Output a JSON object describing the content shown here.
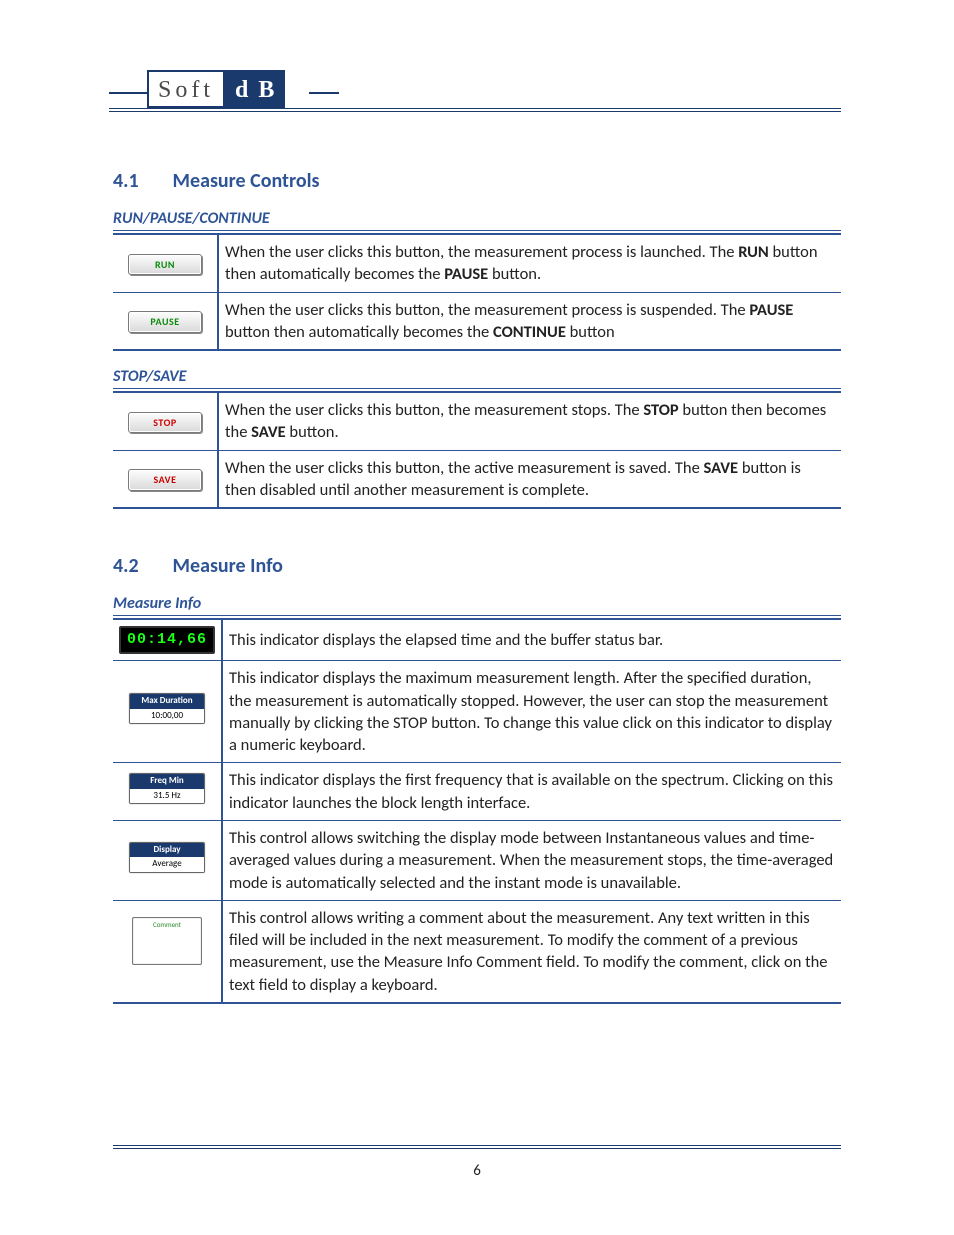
{
  "brand": {
    "left": "Soft",
    "right": "d B"
  },
  "sections": {
    "s41": {
      "num": "4.1",
      "title": "Measure Controls"
    },
    "s42": {
      "num": "4.2",
      "title": "Measure Info"
    }
  },
  "sub_run": "RUN/PAUSE/CONTINUE",
  "sub_stop": "STOP/SAVE",
  "sub_info": "Measure Info",
  "btn": {
    "run": "RUN",
    "pause": "PAUSE",
    "stop": "STOP",
    "save": "SAVE"
  },
  "row_run": {
    "pre": "When the user clicks this button, the measurement process is launched. The ",
    "b1": "RUN",
    "mid": " button then automatically becomes the ",
    "b2": "PAUSE",
    "post": " button."
  },
  "row_pause": {
    "pre": "When the user clicks this button, the measurement process is suspended. The ",
    "b1": "PAUSE",
    "mid": " button then automatically becomes the ",
    "b2": "CONTINUE",
    "post": " button"
  },
  "row_stop": {
    "pre": "When the user clicks this button, the measurement stops. The ",
    "b1": "STOP",
    "mid": " button then becomes the ",
    "b2": "SAVE",
    "post": " button."
  },
  "row_save": {
    "pre": "When the user clicks this button, the active measurement is saved. The ",
    "b1": "SAVE",
    "mid": " button is then disabled until another measurement is complete.",
    "b2": "",
    "post": ""
  },
  "info": {
    "timer_value": "00:14,66",
    "timer_desc": "This indicator displays the elapsed time and the buffer status bar.",
    "maxdur_label": "Max Duration",
    "maxdur_value": "10:00,00",
    "maxdur_desc": "This indicator displays the maximum measurement length. After the specified duration, the measurement is automatically stopped. However, the user can stop the measurement manually by clicking the STOP button. To change this value click on this indicator to display a numeric keyboard.",
    "freq_label": "Freq Min",
    "freq_value": "31.5 Hz",
    "freq_desc": "This indicator displays the first frequency that is available on the spectrum. Clicking on this indicator launches the block length interface.",
    "disp_label": "Display",
    "disp_value": "Average",
    "disp_desc": "This control allows switching the display mode between Instantaneous values and time-averaged values during a measurement. When the measurement stops, the time-averaged mode is automatically selected and the instant mode is unavailable.",
    "comment_label": "Comment",
    "comment_desc": "This control allows writing a comment about the measurement. Any text written in this filed will be included in the next measurement. To modify the comment of a previous measurement, use the Measure Info Comment field. To modify the comment, click on the text field to display a keyboard."
  },
  "page_number": "6"
}
